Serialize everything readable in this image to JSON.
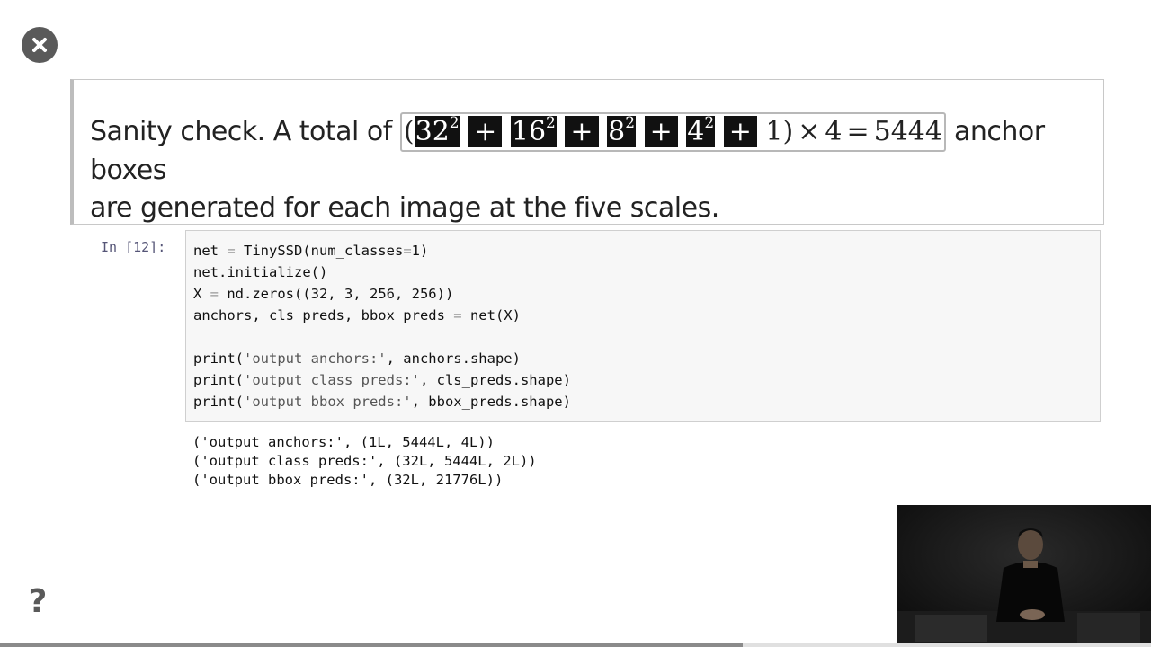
{
  "controls": {
    "close_icon": "close-icon",
    "help_label": "?"
  },
  "markdown": {
    "lead": "Sanity check. A total of ",
    "math": {
      "open_paren": "(",
      "t1_base": "32",
      "t1_exp": "2",
      "plus": "+",
      "t2_base": "16",
      "t2_exp": "2",
      "t3_base": "8",
      "t3_exp": "2",
      "t4_base": "4",
      "t4_exp": "2",
      "t5": "1",
      "close_paren": ")",
      "times": "×",
      "multiplier": "4",
      "equals": "=",
      "result": "5444"
    },
    "tail_line1": " anchor boxes",
    "line2": "are generated for each image at the five scales."
  },
  "code_cell": {
    "prompt": "In [12]:",
    "lines": {
      "l1": {
        "a": "net ",
        "op": "=",
        "b": " TinySSD(num_classes",
        "op2": "=",
        "c": "1)"
      },
      "l2": "net.initialize()",
      "l3": {
        "a": "X ",
        "op": "=",
        "b": " nd.zeros((32, 3, 256, 256))"
      },
      "l4": {
        "a": "anchors, cls_preds, bbox_preds ",
        "op": "=",
        "b": " net(X)"
      },
      "l5": "",
      "l6": {
        "fn": "print(",
        "s": "'output anchors:'",
        "rest": ", anchors.shape)"
      },
      "l7": {
        "fn": "print(",
        "s": "'output class preds:'",
        "rest": ", cls_preds.shape)"
      },
      "l8": {
        "fn": "print(",
        "s": "'output bbox preds:'",
        "rest": ", bbox_preds.shape)"
      }
    }
  },
  "output": [
    "('output anchors:', (1L, 5444L, 4L))",
    "('output class preds:', (32L, 5444L, 2L))",
    "('output bbox preds:', (32L, 21776L))"
  ],
  "playback": {
    "progress_fraction": 0.645
  },
  "colors": {
    "accent_dark": "#111111",
    "prompt": "#555577"
  }
}
